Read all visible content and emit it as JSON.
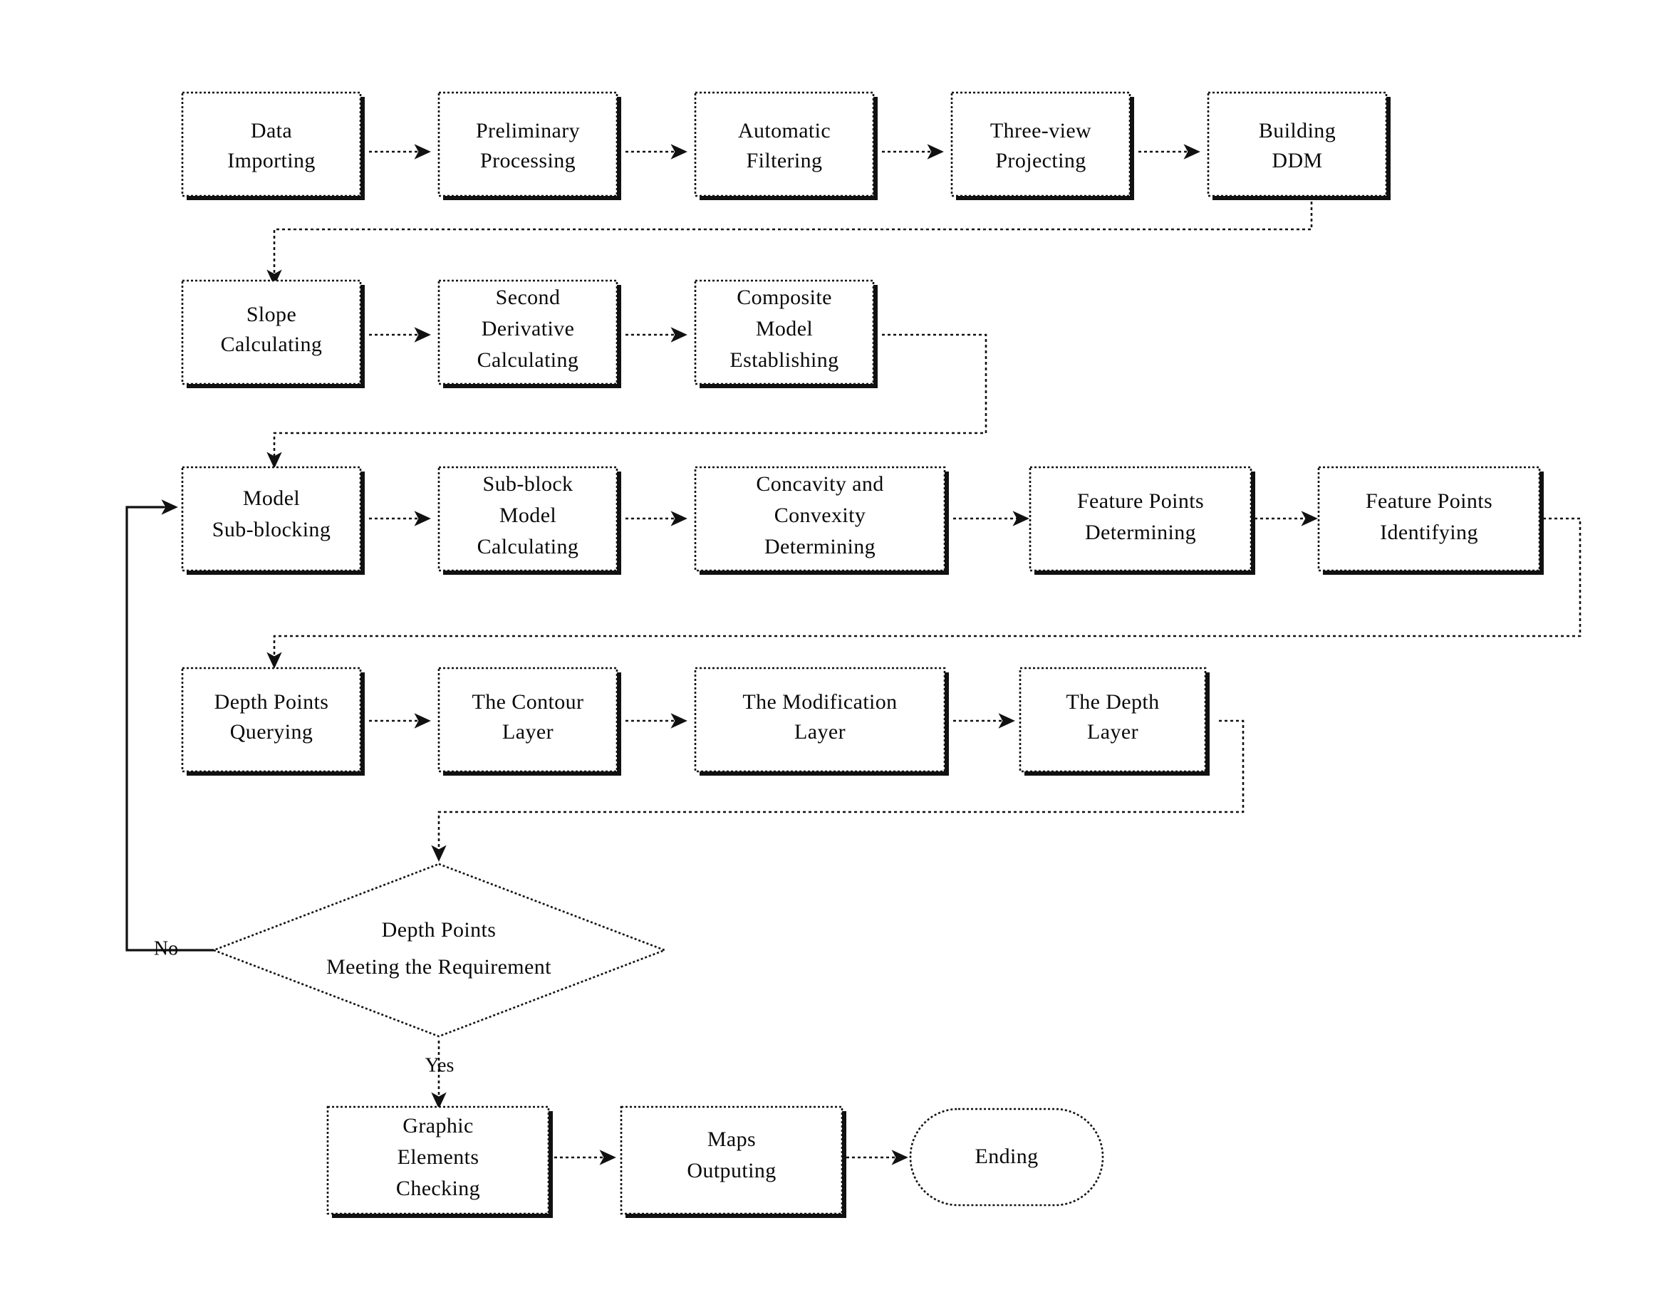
{
  "diagram": {
    "title": "Data Processing and Map Generation Flowchart",
    "type": "flowchart",
    "background_color": "#ffffff",
    "line_color": "#111111",
    "text_color": "#0a0a0a",
    "nodes": [
      {
        "id": "data_importing",
        "shape": "process",
        "lines": [
          "Data",
          "Importing"
        ]
      },
      {
        "id": "preliminary_processing",
        "shape": "process",
        "lines": [
          "Preliminary",
          "Processing"
        ]
      },
      {
        "id": "automatic_filtering",
        "shape": "process",
        "lines": [
          "Automatic",
          "Filtering"
        ]
      },
      {
        "id": "three_view_projecting",
        "shape": "process",
        "lines": [
          "Three-view",
          "Projecting"
        ]
      },
      {
        "id": "building_ddm",
        "shape": "process",
        "lines": [
          "Building",
          "DDM"
        ]
      },
      {
        "id": "slope_calculating",
        "shape": "process",
        "lines": [
          "Slope",
          "Calculating"
        ]
      },
      {
        "id": "second_derivative",
        "shape": "process",
        "lines": [
          "Second",
          "Derivative",
          "Calculating"
        ]
      },
      {
        "id": "composite_model",
        "shape": "process",
        "lines": [
          "Composite",
          "Model",
          "Establishing"
        ]
      },
      {
        "id": "model_sub_blocking",
        "shape": "process",
        "lines": [
          "Model",
          "Sub-blocking"
        ]
      },
      {
        "id": "sub_block_model",
        "shape": "process",
        "lines": [
          "Sub-block",
          "Model",
          "Calculating"
        ]
      },
      {
        "id": "concavity_convexity",
        "shape": "process",
        "lines": [
          "Concavity and",
          "Convexity",
          "Determining"
        ]
      },
      {
        "id": "feature_points_det",
        "shape": "process",
        "lines": [
          "Feature Points",
          "Determining"
        ]
      },
      {
        "id": "feature_points_id",
        "shape": "process",
        "lines": [
          "Feature Points",
          "Identifying"
        ]
      },
      {
        "id": "depth_points_query",
        "shape": "process",
        "lines": [
          "Depth Points",
          "Querying"
        ]
      },
      {
        "id": "contour_layer",
        "shape": "process",
        "lines": [
          "The Contour",
          "Layer"
        ]
      },
      {
        "id": "modification_layer",
        "shape": "process",
        "lines": [
          "The Modification",
          "Layer"
        ]
      },
      {
        "id": "depth_layer",
        "shape": "process",
        "lines": [
          "The Depth",
          "Layer"
        ]
      },
      {
        "id": "decision",
        "shape": "decision",
        "lines": [
          "Depth Points",
          "Meeting the Requirement"
        ]
      },
      {
        "id": "graphic_elements",
        "shape": "process",
        "lines": [
          "Graphic",
          "Elements",
          "Checking"
        ]
      },
      {
        "id": "maps_outputing",
        "shape": "process",
        "lines": [
          "Maps",
          "Outputing"
        ]
      },
      {
        "id": "ending",
        "shape": "terminal",
        "lines": [
          "Ending"
        ]
      }
    ],
    "edge_labels": {
      "no": "No",
      "yes": "Yes"
    }
  }
}
